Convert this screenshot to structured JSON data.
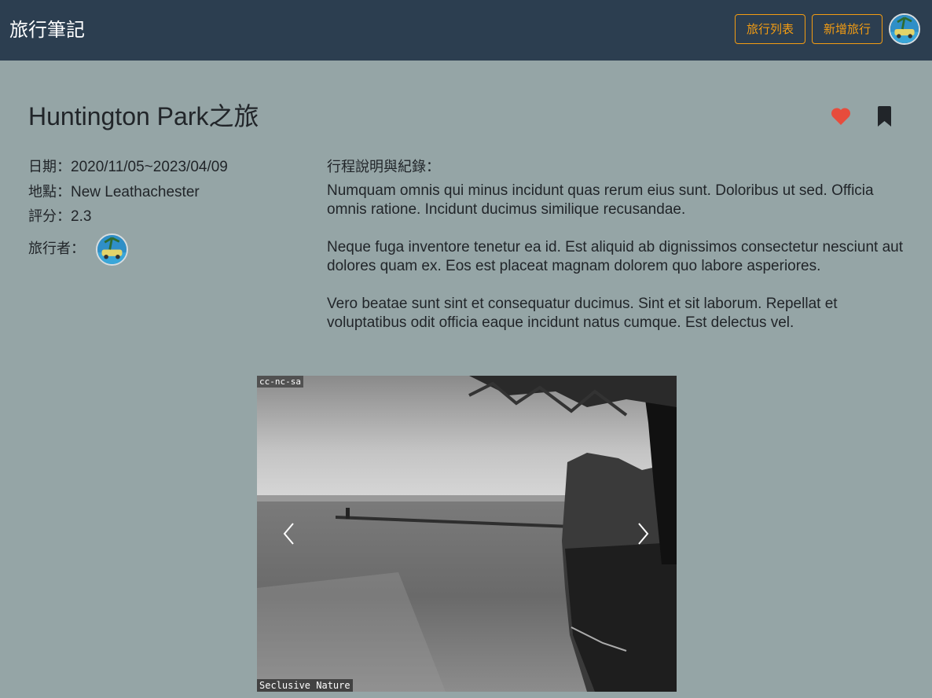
{
  "navbar": {
    "brand": "旅行筆記",
    "list_label": "旅行列表",
    "add_label": "新增旅行"
  },
  "trip": {
    "title": "Huntington Park之旅",
    "date_label": "日期：",
    "date": "2020/11/05~2023/04/09",
    "place_label": "地點：",
    "place": "New Leathachester",
    "rating_label": "評分：",
    "rating": "2.3",
    "traveler_label": "旅行者："
  },
  "description": {
    "label": "行程說明與紀錄：",
    "paragraphs": [
      "Numquam omnis qui minus incidunt quas rerum eius sunt. Doloribus ut sed. Officia omnis ratione. Incidunt ducimus similique recusandae.",
      "Neque fuga inventore tenetur ea id. Est aliquid ab dignissimos consectetur nesciunt aut dolores quam ex. Eos est placeat magnam dolorem quo labore asperiores.",
      "Vero beatae sunt sint et consequatur ducimus. Sint et sit laborum. Repellat et voluptatibus odit officia eaque incidunt natus cumque. Est delectus vel."
    ]
  },
  "carousel": {
    "license_tag": "cc-nc-sa",
    "caption": "Seclusive Nature"
  },
  "icons": {
    "favorite": "heart-icon",
    "bookmark": "bookmark-icon",
    "prev": "chevron-left-icon",
    "next": "chevron-right-icon"
  },
  "colors": {
    "navbar": "#2c3e50",
    "background": "#95a5a6",
    "accent": "#f39c12",
    "heart": "#e74c3c"
  }
}
